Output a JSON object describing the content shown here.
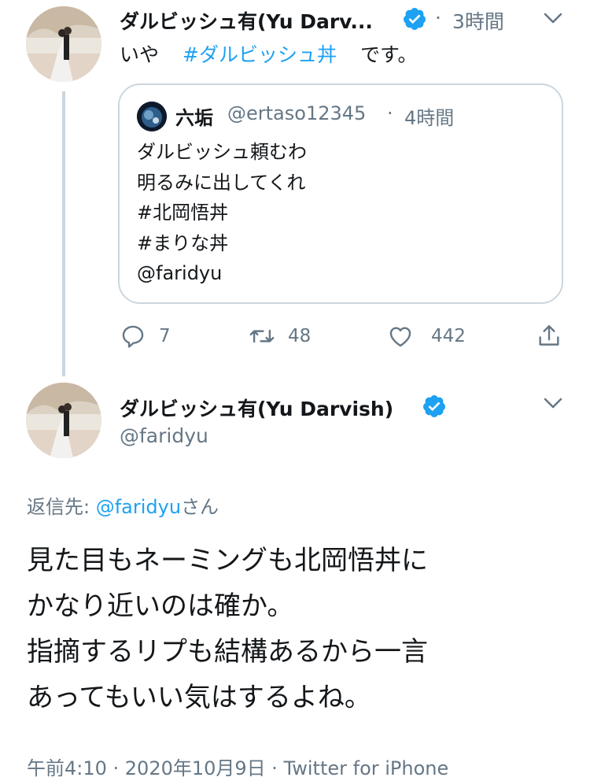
{
  "tweet1": {
    "display_name": "ダルビッシュ有(Yu Darv...",
    "time_separator": "·",
    "time": "3時間",
    "text_before": "いや",
    "hashtag": "#ダルビッシュ丼",
    "text_after": "です。",
    "quote": {
      "display_name": "六垢",
      "handle": "@ertaso12345",
      "separator": "·",
      "time": "4時間",
      "lines": [
        "ダルビッシュ頼むわ",
        "明るみに出してくれ",
        "#北岡悟丼",
        "#まりな丼",
        "@faridyu"
      ]
    },
    "actions": {
      "reply_count": "7",
      "retweet_count": "48",
      "like_count": "442"
    }
  },
  "tweet2": {
    "display_name": "ダルビッシュ有(Yu Darvish)",
    "handle": "@faridyu",
    "reply_to_label": "返信先: ",
    "reply_to_handle": "@faridyu",
    "reply_to_suffix": "さん",
    "lines": [
      "見た目もネーミングも北岡悟丼に",
      "かなり近いのは確か。",
      "指摘するリプも結構あるから一言",
      "あってもいい気はするよね。"
    ],
    "timestamp": "午前4:10 · 2020年10月9日 · Twitter for iPhone"
  },
  "colors": {
    "accent": "#1da1f2",
    "text": "#14171a",
    "muted": "#657786",
    "border": "#ccd6dd"
  },
  "icons": [
    "verified-badge-icon",
    "chevron-down-icon",
    "reply-icon",
    "retweet-icon",
    "like-icon",
    "share-icon"
  ]
}
